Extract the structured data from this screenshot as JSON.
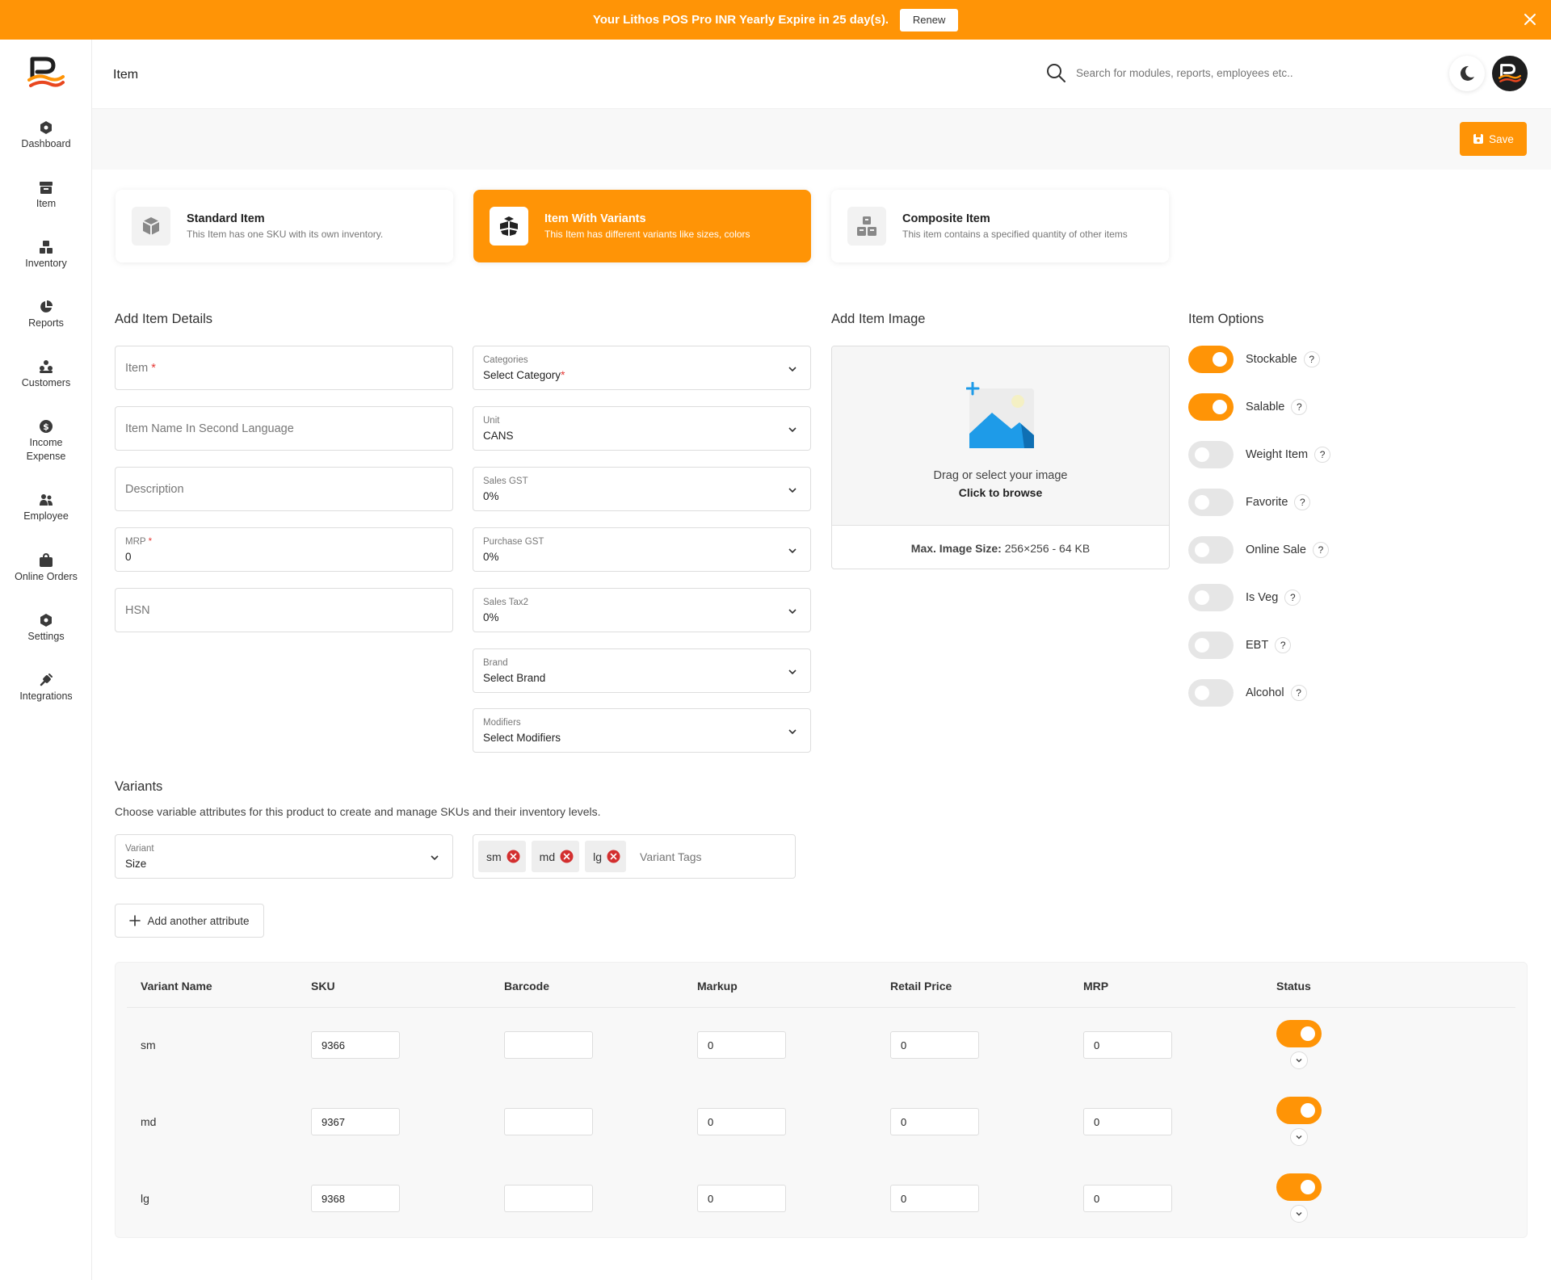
{
  "banner": {
    "text": "Your Lithos POS Pro INR Yearly Expire in 25 day(s).",
    "renew_label": "Renew"
  },
  "sidebar": {
    "items": [
      {
        "label": "Dashboard",
        "icon": "dashboard-icon"
      },
      {
        "label": "Item",
        "icon": "item-icon"
      },
      {
        "label": "Inventory",
        "icon": "inventory-icon"
      },
      {
        "label": "Reports",
        "icon": "reports-icon"
      },
      {
        "label": "Customers",
        "icon": "customers-icon"
      },
      {
        "label": "Income Expense",
        "icon": "income-expense-icon"
      },
      {
        "label": "Employee",
        "icon": "employee-icon"
      },
      {
        "label": "Online Orders",
        "icon": "online-orders-icon"
      },
      {
        "label": "Settings",
        "icon": "settings-icon"
      },
      {
        "label": "Integrations",
        "icon": "integrations-icon"
      }
    ]
  },
  "header": {
    "title": "Item",
    "search_placeholder": "Search for modules, reports, employees etc.."
  },
  "toolbar": {
    "save_label": "Save"
  },
  "item_types": [
    {
      "title": "Standard Item",
      "desc": "This Item has one SKU with its own inventory.",
      "active": false
    },
    {
      "title": "Item With Variants",
      "desc": "This Item has different variants like sizes, colors",
      "active": true
    },
    {
      "title": "Composite Item",
      "desc": "This item contains a specified quantity of other items",
      "active": false
    }
  ],
  "details": {
    "title": "Add Item Details",
    "item_placeholder": "Item",
    "second_lang_placeholder": "Item Name In Second Language",
    "description_placeholder": "Description",
    "mrp_label": "MRP",
    "mrp_value": "0",
    "hsn_placeholder": "HSN",
    "required_mark": "*"
  },
  "selects": [
    {
      "label": "Categories",
      "value": "Select Category",
      "required": true
    },
    {
      "label": "Unit",
      "value": "CANS"
    },
    {
      "label": "Sales GST",
      "value": "0%"
    },
    {
      "label": "Purchase GST",
      "value": "0%"
    },
    {
      "label": "Sales Tax2",
      "value": "0%"
    },
    {
      "label": "Brand",
      "value": "Select Brand"
    },
    {
      "label": "Modifiers",
      "value": "Select Modifiers"
    }
  ],
  "image": {
    "title": "Add Item Image",
    "drop_text": "Drag or select your image",
    "browse_text": "Click to browse",
    "max_label": "Max. Image Size:",
    "max_value": "256×256 - 64 KB"
  },
  "options": {
    "title": "Item Options",
    "help_label": "?",
    "items": [
      {
        "label": "Stockable",
        "on": true
      },
      {
        "label": "Salable",
        "on": true
      },
      {
        "label": "Weight Item",
        "on": false
      },
      {
        "label": "Favorite",
        "on": false
      },
      {
        "label": "Online Sale",
        "on": false
      },
      {
        "label": "Is Veg",
        "on": false
      },
      {
        "label": "EBT",
        "on": false
      },
      {
        "label": "Alcohol",
        "on": false
      }
    ]
  },
  "variants": {
    "title": "Variants",
    "desc": "Choose variable attributes for this product to create and manage SKUs and their inventory levels.",
    "variant_label": "Variant",
    "variant_value": "Size",
    "tags": [
      "sm",
      "md",
      "lg"
    ],
    "tags_placeholder": "Variant Tags",
    "add_attribute_label": "Add another attribute"
  },
  "table": {
    "headers": [
      "Variant Name",
      "SKU",
      "Barcode",
      "Markup",
      "Retail Price",
      "MRP",
      "Status"
    ],
    "rows": [
      {
        "name": "sm",
        "sku": "9366",
        "barcode": "",
        "markup": "0",
        "retail": "0",
        "mrp": "0",
        "status": true
      },
      {
        "name": "md",
        "sku": "9367",
        "barcode": "",
        "markup": "0",
        "retail": "0",
        "mrp": "0",
        "status": true
      },
      {
        "name": "lg",
        "sku": "9368",
        "barcode": "",
        "markup": "0",
        "retail": "0",
        "mrp": "0",
        "status": true
      }
    ]
  },
  "colors": {
    "accent": "#FF9406",
    "required": "#E53935",
    "tag_remove": "#D32F2F",
    "image_blue": "#1E9BE8"
  }
}
